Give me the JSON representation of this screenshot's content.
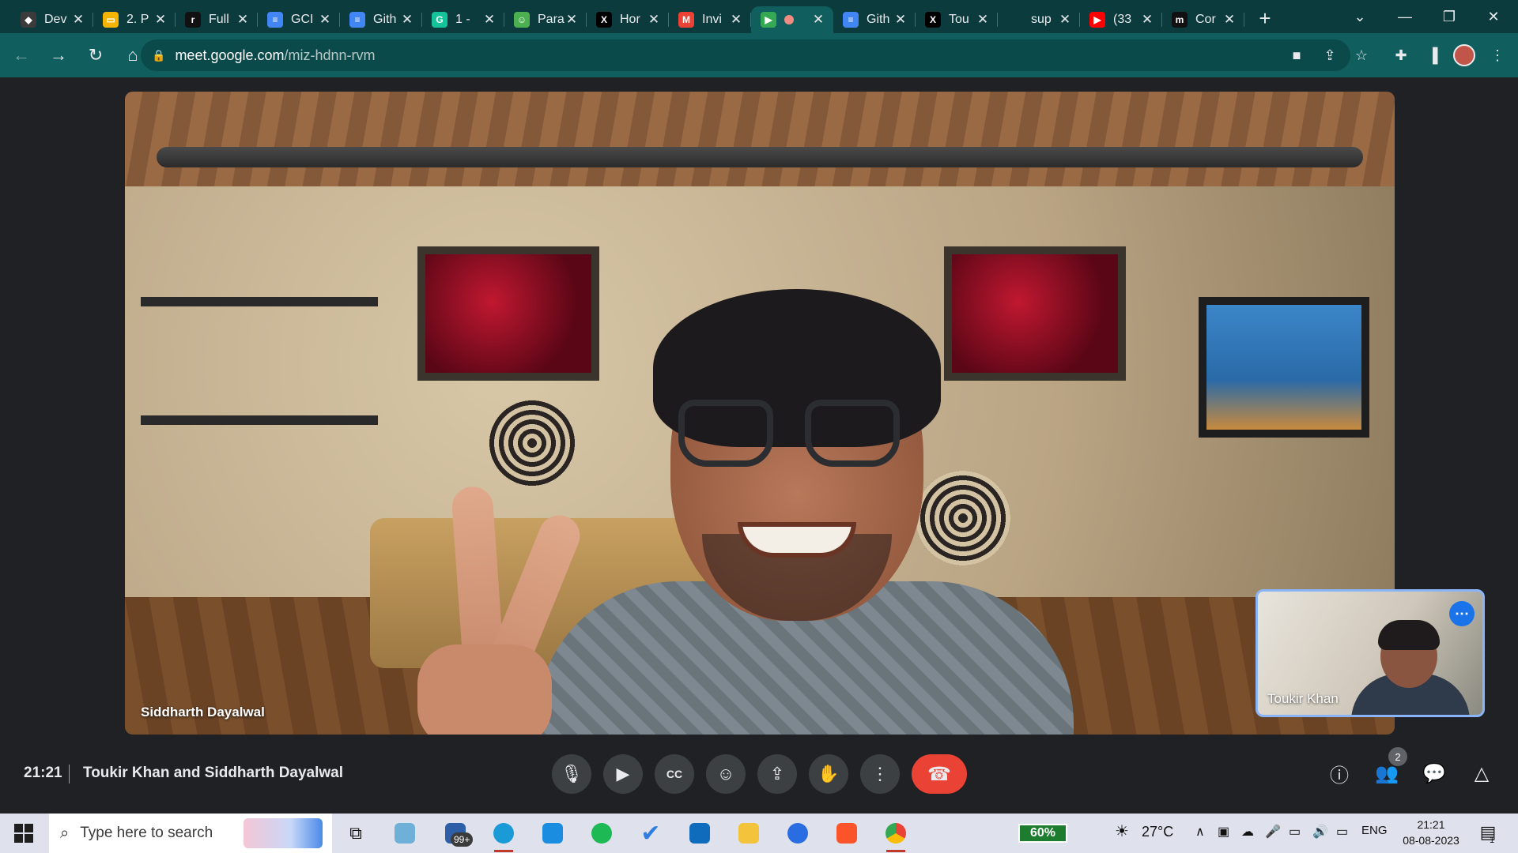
{
  "browser": {
    "tabs": [
      {
        "title": "Dev",
        "color": "#3b3b3b",
        "glyph": "◆",
        "active": false
      },
      {
        "title": "2. P",
        "color": "#f4b400",
        "glyph": "▭",
        "active": false
      },
      {
        "title": "Full",
        "color": "#111111",
        "glyph": "r",
        "active": false
      },
      {
        "title": "GCI",
        "color": "#4285f4",
        "glyph": "≡",
        "active": false
      },
      {
        "title": "Gith",
        "color": "#4285f4",
        "glyph": "≡",
        "active": false
      },
      {
        "title": "1 -",
        "color": "#15c39a",
        "glyph": "G",
        "active": false
      },
      {
        "title": "Para",
        "color": "#4caf50",
        "glyph": "☺",
        "active": false
      },
      {
        "title": "Hor",
        "color": "#000000",
        "glyph": "X",
        "active": false
      },
      {
        "title": "Invi",
        "color": "#ea4335",
        "glyph": "M",
        "active": false
      },
      {
        "title": "",
        "color": "#34a853",
        "glyph": "▶",
        "active": true,
        "recording": true
      },
      {
        "title": "Gith",
        "color": "#4285f4",
        "glyph": "≡",
        "active": false
      },
      {
        "title": "Tou",
        "color": "#000000",
        "glyph": "X",
        "active": false
      },
      {
        "title": "sup",
        "color": "#0b3b3d",
        "glyph": "",
        "active": false
      },
      {
        "title": "(33",
        "color": "#ff0000",
        "glyph": "▶",
        "active": false
      },
      {
        "title": "Cor",
        "color": "#111111",
        "glyph": "m",
        "active": false
      }
    ],
    "new_tab": "+",
    "url_host": "meet.google.com",
    "url_path": "/miz-hdnn-rvm",
    "icons": {
      "back": "arrow-left",
      "forward": "arrow-right",
      "reload": "reload",
      "home": "home",
      "lock": "lock",
      "camera_blocked": "camera",
      "share": "share",
      "bookmark": "star",
      "extensions": "puzzle",
      "side_panel": "side-panel",
      "menu": "kebab"
    }
  },
  "meet": {
    "main_participant": "Siddharth Dayalwal",
    "self_participant": "Toukir Khan",
    "clock": "21:21",
    "meeting_title": "Toukir Khan and Siddharth Dayalwal",
    "participant_count": "2",
    "controls": [
      "microphone",
      "camera",
      "captions",
      "emoji",
      "present",
      "raise-hand",
      "more",
      "end-call"
    ],
    "right_controls": [
      "info",
      "people",
      "chat",
      "activities"
    ],
    "accent": "#8ab4f8",
    "end_call_color": "#ea4335"
  },
  "taskbar": {
    "search_placeholder": "Type here to search",
    "mail_badge": "99+",
    "battery": "60%",
    "weather": "27°C",
    "language": "ENG",
    "time": "21:21",
    "date": "08-08-2023",
    "notification_count": "1",
    "apps": [
      "task-view",
      "notes",
      "mail",
      "edge",
      "linkedin",
      "spotify",
      "todo",
      "outlook",
      "file-explorer",
      "firefox",
      "brave",
      "chrome"
    ]
  }
}
